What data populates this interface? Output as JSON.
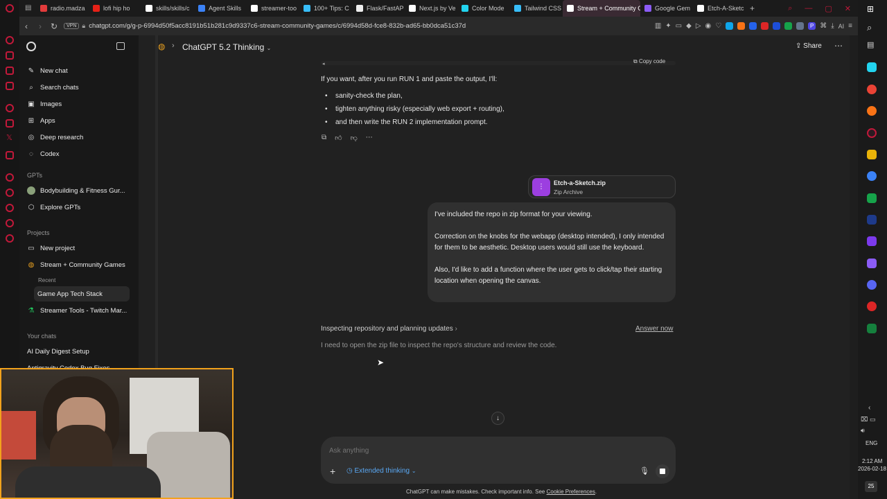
{
  "browser": {
    "tabs": [
      {
        "label": "radio.madza",
        "color": "#e23b3b"
      },
      {
        "label": "lofi hip ho",
        "color": "#e62117"
      },
      {
        "label": "skills/skills/c",
        "color": "#ffffff"
      },
      {
        "label": "Agent Skills",
        "color": "#3b82f6"
      },
      {
        "label": "streamer-too",
        "color": "#ffffff"
      },
      {
        "label": "100+ Tips: C",
        "color": "#38bdf8"
      },
      {
        "label": "Flask/FastAP",
        "color": "#eeeeee"
      },
      {
        "label": "Next.js by Ve",
        "color": "#ffffff"
      },
      {
        "label": "Color Mode",
        "color": "#22d3ee"
      },
      {
        "label": "Tailwind CSS",
        "color": "#38bdf8"
      },
      {
        "label": "Stream + Community G",
        "color": "#ffffff",
        "active": true
      },
      {
        "label": "Google Gem",
        "color": "#8b5cf6"
      },
      {
        "label": "Etch-A-Sketc",
        "color": "#ffffff"
      }
    ],
    "new_tab": "+",
    "vpn_label": "VPN",
    "url": "chatgpt.com/g/g-p-6994d50f5acc8191b51b281c9d9337c6-stream-community-games/c/6994d58d-fce8-832b-ad65-bb0dca51c37d",
    "ai_label": "AI"
  },
  "sidebar": {
    "main_items": [
      {
        "label": "New chat",
        "icon": "pencil-icon",
        "glyph": "✎"
      },
      {
        "label": "Search chats",
        "icon": "search-icon",
        "glyph": "⌕"
      },
      {
        "label": "Images",
        "icon": "image-icon",
        "glyph": "▣"
      },
      {
        "label": "Apps",
        "icon": "apps-icon",
        "glyph": "⊞"
      },
      {
        "label": "Deep research",
        "icon": "research-icon",
        "glyph": "◎"
      },
      {
        "label": "Codex",
        "icon": "codex-icon",
        "glyph": "◌"
      }
    ],
    "gpts_label": "GPTs",
    "gpts": [
      {
        "label": "Bodybuilding & Fitness Gur...",
        "icon": "gpt-avatar-icon"
      },
      {
        "label": "Explore GPTs",
        "icon": "explore-icon"
      }
    ],
    "projects_label": "Projects",
    "projects": [
      {
        "label": "New project",
        "icon": "folder-plus-icon"
      },
      {
        "label": "Stream + Community Games",
        "icon": "globe-icon"
      }
    ],
    "recent_label": "Recent",
    "recent": [
      {
        "label": "Game App Tech Stack"
      }
    ],
    "more_projects": [
      {
        "label": "Streamer Tools - Twitch Mar...",
        "icon": "flask-icon"
      }
    ],
    "your_chats_label": "Your chats",
    "chats": [
      {
        "label": "AI Daily Digest Setup"
      },
      {
        "label": "Antigravity Codex Bug Fixes"
      }
    ]
  },
  "header": {
    "model": "ChatGPT 5.2 Thinking",
    "share": "Share"
  },
  "conversation": {
    "copy_code": "Copy code",
    "intro": "If you want, after you run RUN 1 and paste the output, I'll:",
    "bullets": [
      "sanity-check the plan,",
      "tighten anything risky (especially web export + routing),",
      "and then write the RUN 2 implementation prompt."
    ],
    "attachment": {
      "name": "Etch-a-Sketch.zip",
      "type": "Zip Archive",
      "color": "#9c3fe0"
    },
    "user_message": [
      "I've included the repo in zip format for your viewing.",
      "Correction on the knobs for the webapp (desktop intended), I only intended for them to be aesthetic. Desktop users would still use the keyboard.",
      "Also, I'd like to add a function where the user gets to click/tap their starting location when opening the canvas."
    ],
    "thinking_title": "Inspecting repository and planning updates",
    "answer_now": "Answer now",
    "thinking_text": "I need to open the zip file to inspect the repo's structure and review the code."
  },
  "composer": {
    "placeholder": "Ask anything",
    "mode": "Extended thinking"
  },
  "footer": {
    "text": "ChatGPT can make mistakes. Check important info. See ",
    "link": "Cookie Preferences",
    "end": "."
  },
  "taskbar": {
    "lang": "ENG",
    "time": "2:12 AM",
    "date": "2026-02-18",
    "notif_count": "25"
  }
}
